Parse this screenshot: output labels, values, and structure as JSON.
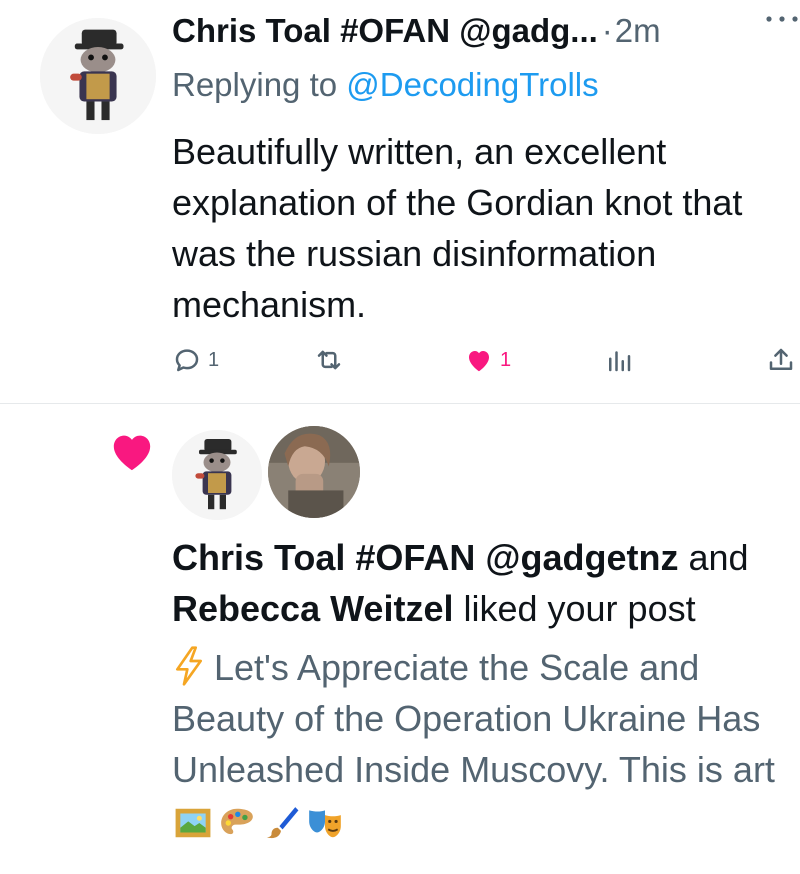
{
  "reply_tweet": {
    "author_display": "Chris Toal #OFAN @gadg...",
    "separator": "·",
    "time": "2m",
    "replying_prefix": "Replying to ",
    "replying_handle": "@DecodingTrolls",
    "text": "Beautifully written, an excellent explanation of the Gordian knot that was the russian disinformation mechanism.",
    "reply_count": "1",
    "like_count": "1",
    "icons": [
      "more-icon",
      "reply-icon",
      "retweet-icon",
      "like-icon",
      "views-icon",
      "share-icon"
    ],
    "colors": {
      "link": "#1d9bf0",
      "like": "#f91880",
      "muted": "#536471"
    }
  },
  "like_notification": {
    "user1": "Chris Toal #OFAN @gadgetnz",
    "and_word": " and ",
    "user2": "Rebecca Weitzel",
    "action_text": " liked your post",
    "post_preview": "Let's Appreciate the Scale and Beauty of the Operation Ukraine Has Unleashed Inside Muscovy. This is art",
    "icons": [
      "heart-icon",
      "lightning-icon",
      "framed-picture-icon",
      "palette-icon",
      "paintbrush-icon",
      "theater-masks-icon"
    ]
  }
}
